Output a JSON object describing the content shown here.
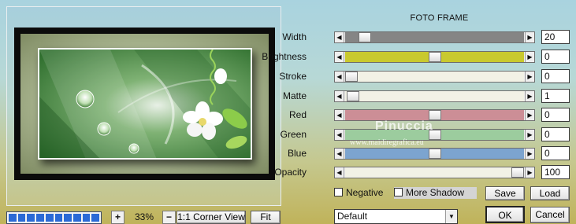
{
  "title": "FOTO FRAME",
  "zoom": "33%",
  "buttons": {
    "zoom_in": "+",
    "zoom_out": "−",
    "corner_view": "1:1 Corner View",
    "fit": "Fit",
    "save": "Save",
    "load": "Load",
    "ok": "OK",
    "cancel": "Cancel"
  },
  "progress_segments": 10,
  "sliders": [
    {
      "label": "Width",
      "value": "20",
      "fraction": 0.08,
      "color": "#858585"
    },
    {
      "label": "Brightness",
      "value": "0",
      "fraction": 0.5,
      "color": "#c9c92e"
    },
    {
      "label": "Stroke",
      "value": "0",
      "fraction": 0.0,
      "color": "#f2f2e6"
    },
    {
      "label": "Matte",
      "value": "1",
      "fraction": 0.01,
      "color": "#f2f2e6"
    },
    {
      "label": "Red",
      "value": "0",
      "fraction": 0.5,
      "color": "#cc8e96"
    },
    {
      "label": "Green",
      "value": "0",
      "fraction": 0.5,
      "color": "#9ccc9e"
    },
    {
      "label": "Blue",
      "value": "0",
      "fraction": 0.5,
      "color": "#7ca4cf"
    },
    {
      "label": "Opacity",
      "value": "100",
      "fraction": 1.0,
      "color": "#f2f2e6"
    }
  ],
  "checkboxes": {
    "negative": "Negative",
    "more_shadow": "More Shadow"
  },
  "preset": "Default",
  "watermark": {
    "name": "Pinuccia",
    "url": "www.maidiregrafica.eu"
  }
}
